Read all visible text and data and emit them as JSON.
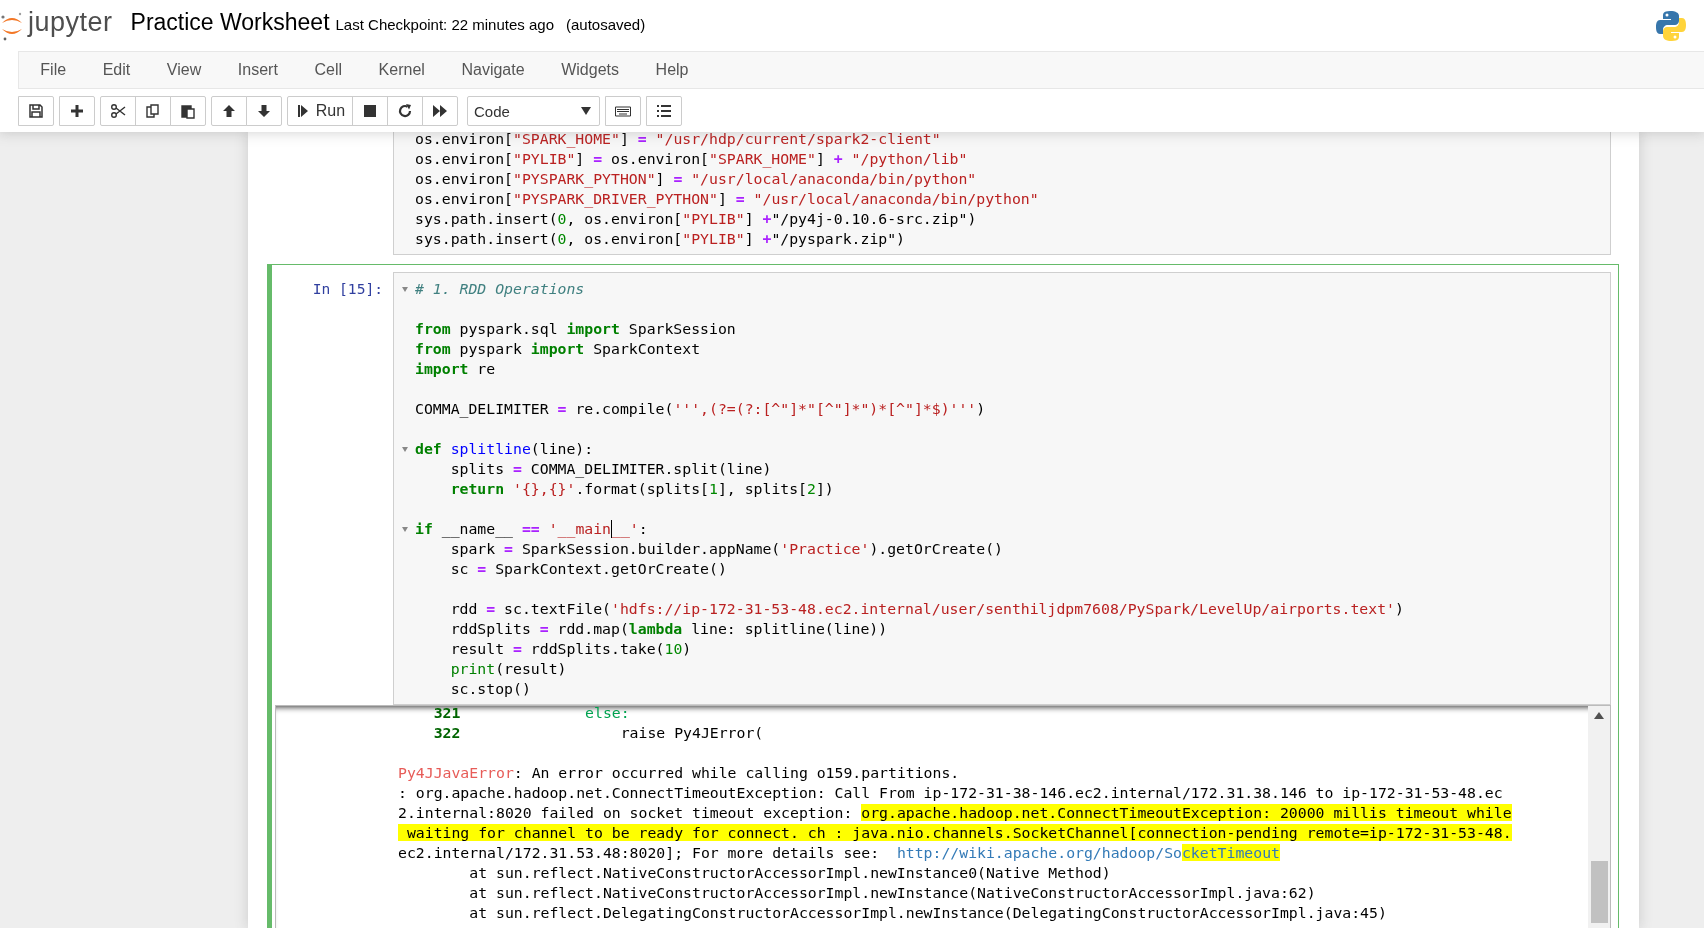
{
  "header": {
    "logo_text": "jupyter",
    "notebook_title": "Practice Worksheet",
    "checkpoint": "Last Checkpoint: 22 minutes ago",
    "autosave": "(autosaved)"
  },
  "menu": [
    "File",
    "Edit",
    "View",
    "Insert",
    "Cell",
    "Kernel",
    "Navigate",
    "Widgets",
    "Help"
  ],
  "toolbar": {
    "run_label": "Run",
    "cell_type": "Code"
  },
  "cells": [
    {
      "selected": false,
      "blocks": [
        {
          "lines": [
            {
              "tokens": [
                {
                  "kind": "plain",
                  "text": "os.environ["
                },
                {
                  "kind": "str",
                  "text": "\"SPARK_HOME\""
                },
                {
                  "kind": "plain",
                  "text": "] "
                },
                {
                  "kind": "op",
                  "text": "="
                },
                {
                  "kind": "str",
                  "text": " \"/usr/hdp/current/spark2-client\""
                }
              ]
            },
            {
              "tokens": [
                {
                  "kind": "plain",
                  "text": "os.environ["
                },
                {
                  "kind": "str",
                  "text": "\"PYLIB\""
                },
                {
                  "kind": "plain",
                  "text": "] "
                },
                {
                  "kind": "op",
                  "text": "="
                },
                {
                  "kind": "plain",
                  "text": " os.environ["
                },
                {
                  "kind": "str",
                  "text": "\"SPARK_HOME\""
                },
                {
                  "kind": "plain",
                  "text": "] "
                },
                {
                  "kind": "op",
                  "text": "+"
                },
                {
                  "kind": "str",
                  "text": " \"/python/lib\""
                }
              ]
            },
            {
              "tokens": [
                {
                  "kind": "plain",
                  "text": "os.environ["
                },
                {
                  "kind": "str",
                  "text": "\"PYSPARK_PYTHON\""
                },
                {
                  "kind": "plain",
                  "text": "] "
                },
                {
                  "kind": "op",
                  "text": "="
                },
                {
                  "kind": "str",
                  "text": " \"/usr/local/anaconda/bin/python\""
                }
              ]
            },
            {
              "tokens": [
                {
                  "kind": "plain",
                  "text": "os.environ["
                },
                {
                  "kind": "str",
                  "text": "\"PYSPARK_DRIVER_PYTHON\""
                },
                {
                  "kind": "plain",
                  "text": "] "
                },
                {
                  "kind": "op",
                  "text": "="
                },
                {
                  "kind": "str",
                  "text": " \"/usr/local/anaconda/bin/python\""
                }
              ]
            },
            {
              "tokens": [
                {
                  "kind": "plain",
                  "text": "sys.path.insert("
                },
                {
                  "kind": "num",
                  "text": "0"
                },
                {
                  "kind": "plain",
                  "text": ", os.environ["
                },
                {
                  "kind": "str",
                  "text": "\"PYLIB\""
                },
                {
                  "kind": "plain",
                  "text": "] "
                },
                {
                  "kind": "op",
                  "text": "+"
                },
                {
                  "kind": "plain",
                  "text": "\"/py4j-0.10.6-src.zip\")"
                }
              ]
            },
            {
              "tokens": [
                {
                  "kind": "plain",
                  "text": "sys.path.insert("
                },
                {
                  "kind": "num",
                  "text": "0"
                },
                {
                  "kind": "plain",
                  "text": ", os.environ["
                },
                {
                  "kind": "str",
                  "text": "\"PYLIB\""
                },
                {
                  "kind": "plain",
                  "text": "] "
                },
                {
                  "kind": "op",
                  "text": "+"
                },
                {
                  "kind": "plain",
                  "text": "\"/pyspark.zip\")"
                }
              ]
            }
          ]
        }
      ]
    },
    {
      "selected": true,
      "prompt": "In [15]:",
      "blocks": [
        {
          "lines": [
            {
              "fold": true,
              "tokens": [
                {
                  "kind": "comment",
                  "text": "# 1. RDD Operations"
                }
              ]
            }
          ]
        },
        {
          "lines": [
            {
              "tokens": [
                {
                  "kind": "kw",
                  "text": "from"
                },
                {
                  "kind": "plain",
                  "text": " pyspark.sql "
                },
                {
                  "kind": "kw",
                  "text": "import"
                },
                {
                  "kind": "plain",
                  "text": " SparkSession"
                }
              ]
            },
            {
              "tokens": [
                {
                  "kind": "kw",
                  "text": "from"
                },
                {
                  "kind": "plain",
                  "text": " pyspark "
                },
                {
                  "kind": "kw",
                  "text": "import"
                },
                {
                  "kind": "plain",
                  "text": " SparkContext"
                }
              ]
            },
            {
              "tokens": [
                {
                  "kind": "kw",
                  "text": "import"
                },
                {
                  "kind": "plain",
                  "text": " re"
                }
              ]
            }
          ]
        },
        {
          "lines": [
            {
              "tokens": [
                {
                  "kind": "plain",
                  "text": "COMMA_DELIMITER "
                },
                {
                  "kind": "op",
                  "text": "="
                },
                {
                  "kind": "plain",
                  "text": " re.compile("
                },
                {
                  "kind": "str",
                  "text": "''',(?=(?:[^\"]*\"[^\"]*\")*[^\"]*$)'''"
                },
                {
                  "kind": "plain",
                  "text": ")"
                }
              ]
            }
          ]
        },
        {
          "lines": [
            {
              "fold": true,
              "tokens": [
                {
                  "kind": "kw",
                  "text": "def"
                },
                {
                  "kind": "def",
                  "text": " splitline"
                },
                {
                  "kind": "plain",
                  "text": "(line):"
                }
              ]
            },
            {
              "tokens": [
                {
                  "kind": "plain",
                  "text": "    splits "
                },
                {
                  "kind": "op",
                  "text": "="
                },
                {
                  "kind": "plain",
                  "text": " COMMA_DELIMITER.split(line)"
                }
              ]
            },
            {
              "tokens": [
                {
                  "kind": "kw",
                  "text": "    return"
                },
                {
                  "kind": "str",
                  "text": " '{},{}'"
                },
                {
                  "kind": "plain",
                  "text": ".format(splits["
                },
                {
                  "kind": "num",
                  "text": "1"
                },
                {
                  "kind": "plain",
                  "text": "], splits["
                },
                {
                  "kind": "num",
                  "text": "2"
                },
                {
                  "kind": "plain",
                  "text": "])"
                }
              ]
            }
          ]
        },
        {
          "lines": [
            {
              "fold": true,
              "tokens": [
                {
                  "kind": "kw",
                  "text": "if"
                },
                {
                  "kind": "plain",
                  "text": " __name__ "
                },
                {
                  "kind": "op",
                  "text": "=="
                },
                {
                  "kind": "str",
                  "text": " '__main"
                },
                {
                  "kind": "cursor"
                },
                {
                  "kind": "str",
                  "text": "__'"
                },
                {
                  "kind": "plain",
                  "text": ":"
                }
              ]
            },
            {
              "tokens": [
                {
                  "kind": "plain",
                  "text": "    spark "
                },
                {
                  "kind": "op",
                  "text": "="
                },
                {
                  "kind": "plain",
                  "text": " SparkSession.builder.appName("
                },
                {
                  "kind": "str",
                  "text": "'Practice'"
                },
                {
                  "kind": "plain",
                  "text": ").getOrCreate()"
                }
              ]
            },
            {
              "tokens": [
                {
                  "kind": "plain",
                  "text": "    sc "
                },
                {
                  "kind": "op",
                  "text": "="
                },
                {
                  "kind": "plain",
                  "text": " SparkContext.getOrCreate()"
                }
              ]
            }
          ]
        },
        {
          "lines": [
            {
              "tokens": [
                {
                  "kind": "plain",
                  "text": "    rdd "
                },
                {
                  "kind": "op",
                  "text": "="
                },
                {
                  "kind": "plain",
                  "text": " sc.textFile("
                },
                {
                  "kind": "str",
                  "text": "'hdfs://ip-172-31-53-48.ec2.internal/user/senthiljdpm7608/PySpark/LevelUp/airports.text'"
                },
                {
                  "kind": "plain",
                  "text": ")"
                }
              ]
            },
            {
              "tokens": [
                {
                  "kind": "plain",
                  "text": "    rddSplits "
                },
                {
                  "kind": "op",
                  "text": "="
                },
                {
                  "kind": "plain",
                  "text": " rdd.map("
                },
                {
                  "kind": "kw",
                  "text": "lambda"
                },
                {
                  "kind": "plain",
                  "text": " line: splitline(line))"
                }
              ]
            },
            {
              "tokens": [
                {
                  "kind": "plain",
                  "text": "    result "
                },
                {
                  "kind": "op",
                  "text": "="
                },
                {
                  "kind": "plain",
                  "text": " rddSplits.take("
                },
                {
                  "kind": "num",
                  "text": "10"
                },
                {
                  "kind": "plain",
                  "text": ")"
                }
              ]
            },
            {
              "tokens": [
                {
                  "kind": "builtin",
                  "text": "    print"
                },
                {
                  "kind": "plain",
                  "text": "(result)"
                }
              ]
            },
            {
              "tokens": [
                {
                  "kind": "plain",
                  "text": "    sc.stop()"
                }
              ]
            }
          ]
        }
      ],
      "output": [
        {
          "lines": [
            {
              "tokens": [
                {
                  "kind": "lineno",
                  "text": "    321"
                },
                {
                  "kind": "green",
                  "text": "              else:"
                }
              ]
            },
            {
              "tokens": [
                {
                  "kind": "lineno",
                  "text": "    322"
                },
                {
                  "kind": "text",
                  "text": "                  raise Py4JError("
                }
              ]
            }
          ]
        },
        {
          "lines": [
            {
              "tokens": [
                {
                  "kind": "error",
                  "text": "Py4JJavaError"
                },
                {
                  "kind": "text",
                  "text": ": An error occurred while calling o159.partitions."
                }
              ]
            },
            {
              "tokens": [
                {
                  "kind": "text",
                  "text": ": org.apache.hadoop.net.ConnectTimeoutException: Call From ip-172-31-38-146.ec2.internal/172.31.38.146 to ip-172-31-53-48.ec"
                }
              ]
            },
            {
              "tokens": [
                {
                  "kind": "text",
                  "text": "2.internal:8020 failed on socket timeout exception: "
                },
                {
                  "kind": "mark",
                  "text": "org.apache.hadoop.net.ConnectTimeoutException: 20000 millis timeout while"
                }
              ]
            },
            {
              "tokens": [
                {
                  "kind": "mark",
                  "text": " waiting for channel to be ready for connect. ch : java.nio.channels.SocketChannel[connection-pending remote=ip-172-31-53-48."
                }
              ]
            },
            {
              "tokens": [
                {
                  "kind": "text",
                  "text": "ec2.internal/172.31.53.48:8020]; For more details see:  "
                },
                {
                  "kind": "link",
                  "segments": [
                    {
                      "kind": "text",
                      "text": "http://wiki.apache.org/hadoop/So"
                    },
                    {
                      "kind": "mark",
                      "text": "cketTimeout"
                    }
                  ]
                }
              ]
            },
            {
              "tokens": [
                {
                  "kind": "text",
                  "text": "        at sun.reflect.NativeConstructorAccessorImpl.newInstance0(Native Method)"
                }
              ]
            },
            {
              "tokens": [
                {
                  "kind": "text",
                  "text": "        at sun.reflect.NativeConstructorAccessorImpl.newInstance(NativeConstructorAccessorImpl.java:62)"
                }
              ]
            },
            {
              "tokens": [
                {
                  "kind": "text",
                  "text": "        at sun.reflect.DelegatingConstructorAccessorImpl.newInstance(DelegatingConstructorAccessorImpl.java:45)"
                }
              ]
            }
          ]
        }
      ]
    }
  ]
}
